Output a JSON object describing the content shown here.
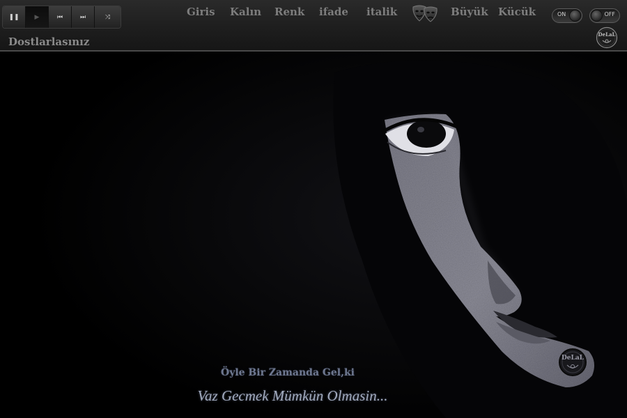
{
  "player": {
    "buttons": [
      {
        "icon": "pause-icon",
        "glyph": "❚❚"
      },
      {
        "icon": "play-icon",
        "glyph": "▶"
      },
      {
        "icon": "previous-track-icon",
        "glyph": "⏮"
      },
      {
        "icon": "next-track-icon",
        "glyph": "⏭"
      },
      {
        "icon": "shuffle-icon",
        "glyph": "⤨"
      }
    ]
  },
  "menu": {
    "giris": "Giris",
    "kalin": "Kalın",
    "renk": "Renk",
    "ifade": "ifade",
    "italik": "italik",
    "buyuk": "Büyük",
    "kucuk": "Kücük"
  },
  "toggles": {
    "on_label": "ON",
    "off_label": "OFF"
  },
  "friends_label": "Dostlarlasınız",
  "logo": {
    "text": "DeLaL"
  },
  "artwork": {
    "signature": "DeLaL",
    "caption_line1": "Öyle Bir Zamanda Gel,ki",
    "caption_line2": "Vaz Gecmek Mümkün Olmasin..."
  },
  "colors": {
    "background": "#000000",
    "topbar": "#202020",
    "menu_text": "#7d7d7d",
    "face_tone": "#8a8a96",
    "caption_line1": "#6e7890",
    "caption_line2": "#a3acc0"
  }
}
